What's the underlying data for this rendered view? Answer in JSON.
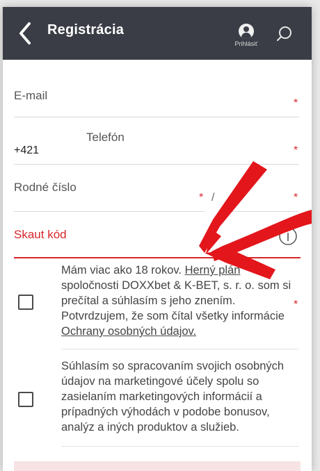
{
  "header": {
    "title": "Registrácia",
    "login_label": "Prihlásiť",
    "icons": [
      "chevron-left-icon",
      "user-icon",
      "search-icon"
    ],
    "bg_color": "#3a3d45"
  },
  "form": {
    "email_label": "E-mail",
    "phone_prefix": "+421",
    "phone_label": "Telefón",
    "birth_number_label": "Rodné číslo",
    "birth_number_separator": "/",
    "scout_label": "Skaut kód",
    "required_mark": "*",
    "accent_color": "#d7262b"
  },
  "consents": [
    {
      "text_before": "Mám viac ako 18 rokov. ",
      "link1": "Herný plán",
      "text_middle": " spoločnosti DOXXbet & K-BET, s. r. o. som si prečítal a súhlasím s jeho znením. Potvrdzujem, že som čítal všetky informácie ",
      "link2": "Ochrany osobných údajov.",
      "required": "*"
    },
    {
      "text": "Súhlasím so spracovaním svojich osobných údajov na marketingové účely spolu so zasielaním marketingových informácií a prípadných výhodách v podobe bonusov, analýz a iných produktov a služieb."
    }
  ]
}
